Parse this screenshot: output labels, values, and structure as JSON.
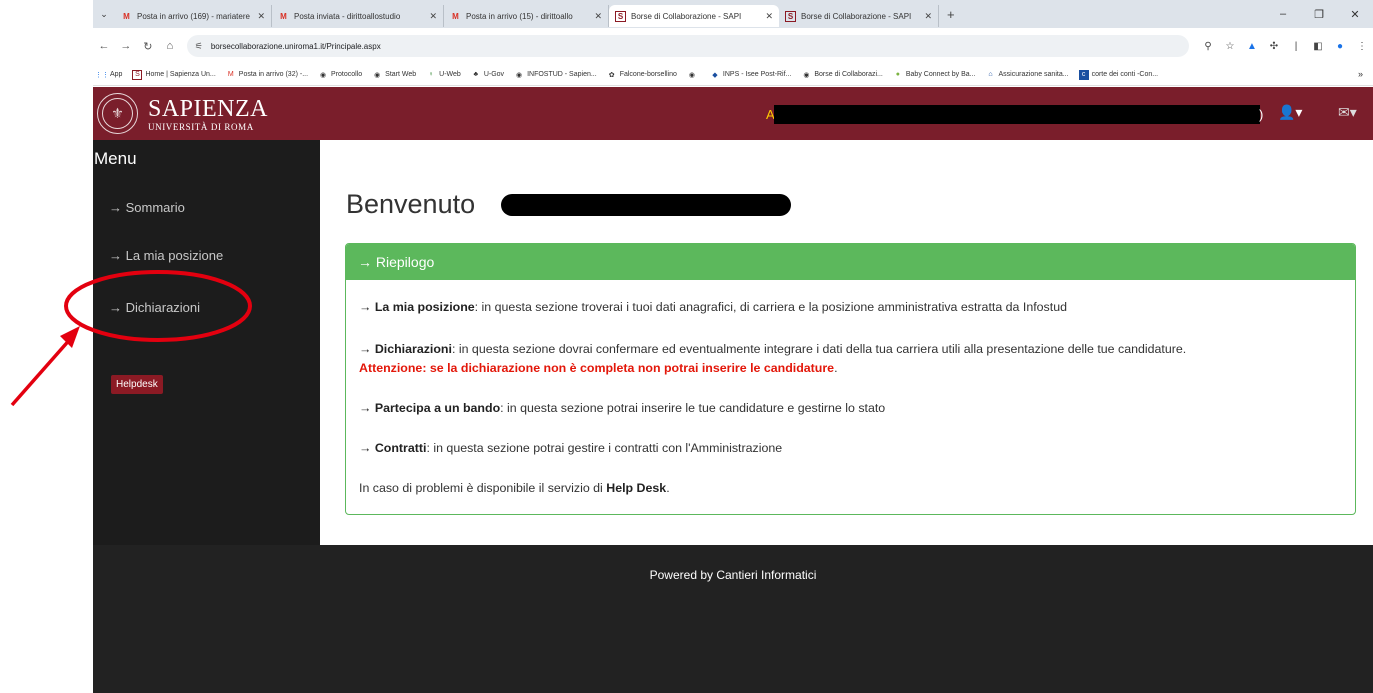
{
  "browser": {
    "tabs": [
      {
        "icon": "gmail-icon",
        "title": "Posta in arrivo (169) - mariatere",
        "active": false
      },
      {
        "icon": "gmail-icon",
        "title": "Posta inviata - dirittoallostudio",
        "active": false
      },
      {
        "icon": "gmail-icon",
        "title": "Posta in arrivo (15) - dirittoallo",
        "active": false
      },
      {
        "icon": "sapienza-icon",
        "title": "Borse di Collaborazione - SAPI",
        "active": true
      },
      {
        "icon": "sapienza-icon",
        "title": "Borse di Collaborazione - SAPI",
        "active": false
      }
    ],
    "url": "borsecollaborazione.uniroma1.it/Principale.aspx",
    "bookmarks": [
      "App",
      "Home | Sapienza Un...",
      "Posta in arrivo (32) -...",
      "Protocollo",
      "Start Web",
      "U-Web",
      "U-Gov",
      "INFOSTUD - Sapien...",
      "Falcone-borsellino",
      "",
      "INPS - Isee Post-Rif...",
      "Borse di Collaborazi...",
      "Baby Connect by Ba...",
      "Assicurazione sanita...",
      "corte dei conti -Con..."
    ]
  },
  "header": {
    "logo_title": "SAPIENZA",
    "logo_subtitle": "UNIVERSITÀ DI ROMA",
    "user_prefix": "A",
    "user_suffix": ")",
    "accent_color": "#7a1e2b"
  },
  "sidebar": {
    "title": "Menu",
    "items": [
      {
        "label": "→ Sommario"
      },
      {
        "label": "→ La mia posizione"
      },
      {
        "label": "→ Dichiarazioni"
      }
    ],
    "helpdesk_label": "Helpdesk"
  },
  "main": {
    "welcome": "Benvenuto",
    "panel_title": "→ Riepilogo",
    "items": [
      {
        "bold": "→ La mia posizione",
        "text": ": in questa sezione troverai i tuoi dati anagrafici, di carriera e la posizione amministrativa estratta da Infostud"
      },
      {
        "bold": "→ Dichiarazioni",
        "text": ": in questa sezione dovrai confermare ed eventualmente integrare i dati della tua carriera utili alla presentazione delle tue candidature.",
        "warning": "Attenzione: se la dichiarazione non è completa non potrai inserire le candidature"
      },
      {
        "bold": "→ Partecipa a un bando",
        "text": ": in questa sezione potrai inserire le tue candidature e gestirne lo stato"
      },
      {
        "bold": "→ Contratti",
        "text": ": in questa sezione potrai gestire i contratti con l'Amministrazione"
      }
    ],
    "help_text": "In caso di problemi è disponibile il servizio di",
    "help_bold": "Help Desk"
  },
  "footer": {
    "text": "Powered by Cantieri Informatici"
  }
}
